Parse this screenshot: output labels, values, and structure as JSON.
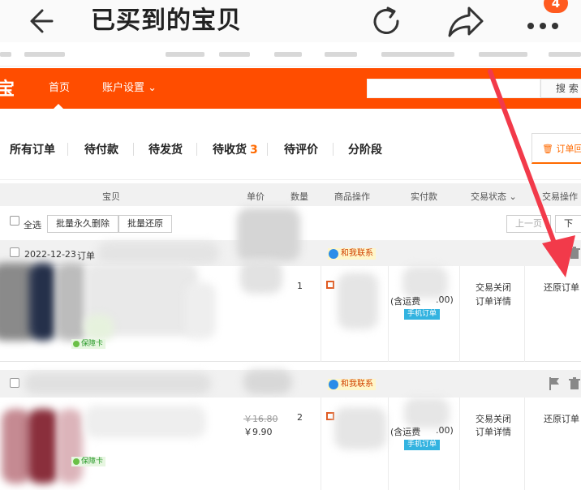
{
  "header": {
    "title": "已买到的宝贝",
    "badge": "4"
  },
  "nav": {
    "logo": "宝",
    "home": "首页",
    "account": "账户设置 ⌄",
    "search_button": "搜 索",
    "search_placeholder": ""
  },
  "tabs": [
    {
      "label": "所有订单"
    },
    {
      "label": "待付款"
    },
    {
      "label": "待发货"
    },
    {
      "label": "待收货",
      "count": "3"
    },
    {
      "label": "待评价"
    },
    {
      "label": "分阶段"
    }
  ],
  "recycle_label": "订单回收站",
  "columns": [
    "宝贝",
    "单价",
    "数量",
    "商品操作",
    "实付款",
    "交易状态 ⌄",
    "交易操作"
  ],
  "bulk": {
    "select_all": "全选",
    "delete_forever": "批量永久删除",
    "restore": "批量还原",
    "prev": "上一页",
    "next": "下一页"
  },
  "orders": [
    {
      "date": "2022-12-23",
      "order_label": "订单",
      "chat": "和我联系",
      "qty": "1",
      "shipping": "(含运费",
      "price_tail": ".00)",
      "mobile": "手机订单",
      "status": "交易关闭",
      "detail": "订单详情",
      "action": "还原订单",
      "guarantee": "保障卡"
    },
    {
      "chat": "和我联系",
      "orig_price": "￥16.80",
      "price": "￥9.90",
      "qty": "2",
      "shipping": "(含运费",
      "price_tail": ".00)",
      "mobile": "手机订单",
      "status": "交易关闭",
      "detail": "订单详情",
      "action": "还原订单",
      "guarantee": "保障卡"
    }
  ],
  "colors": {
    "brand": "#ff4d00",
    "accent": "#ff6a00",
    "arrow": "#f23a4a"
  }
}
